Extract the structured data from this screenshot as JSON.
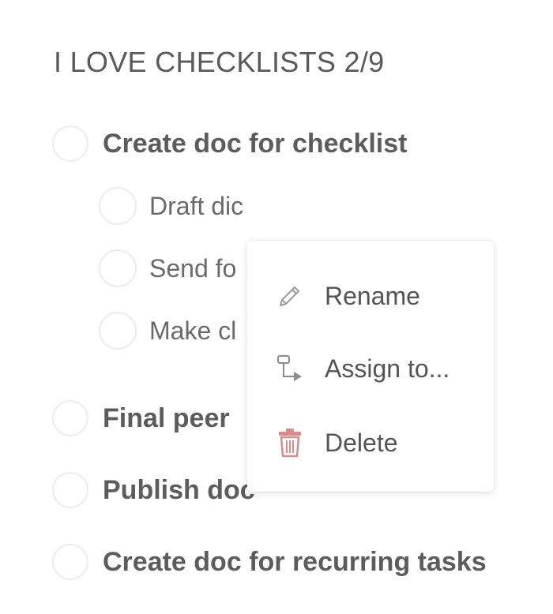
{
  "checklist": {
    "title": "I LOVE CHECKLISTS 2/9",
    "items": [
      {
        "label": "Create doc for checklist",
        "level": 0,
        "checked": false
      },
      {
        "label": "Draft dic",
        "level": 1,
        "checked": false
      },
      {
        "label": "Send fo",
        "level": 1,
        "checked": false
      },
      {
        "label": "Make cl",
        "level": 1,
        "checked": false
      },
      {
        "label": "Final peer",
        "level": 0,
        "checked": false
      },
      {
        "label": "Publish doc",
        "level": 0,
        "checked": false
      },
      {
        "label": "Create doc for recurring tasks",
        "level": 0,
        "checked": false
      }
    ]
  },
  "context_menu": {
    "items": [
      {
        "label": "Rename",
        "icon": "pencil-icon"
      },
      {
        "label": "Assign to...",
        "icon": "assign-icon"
      },
      {
        "label": "Delete",
        "icon": "trash-icon",
        "icon_color": "#d98a8a"
      }
    ]
  }
}
